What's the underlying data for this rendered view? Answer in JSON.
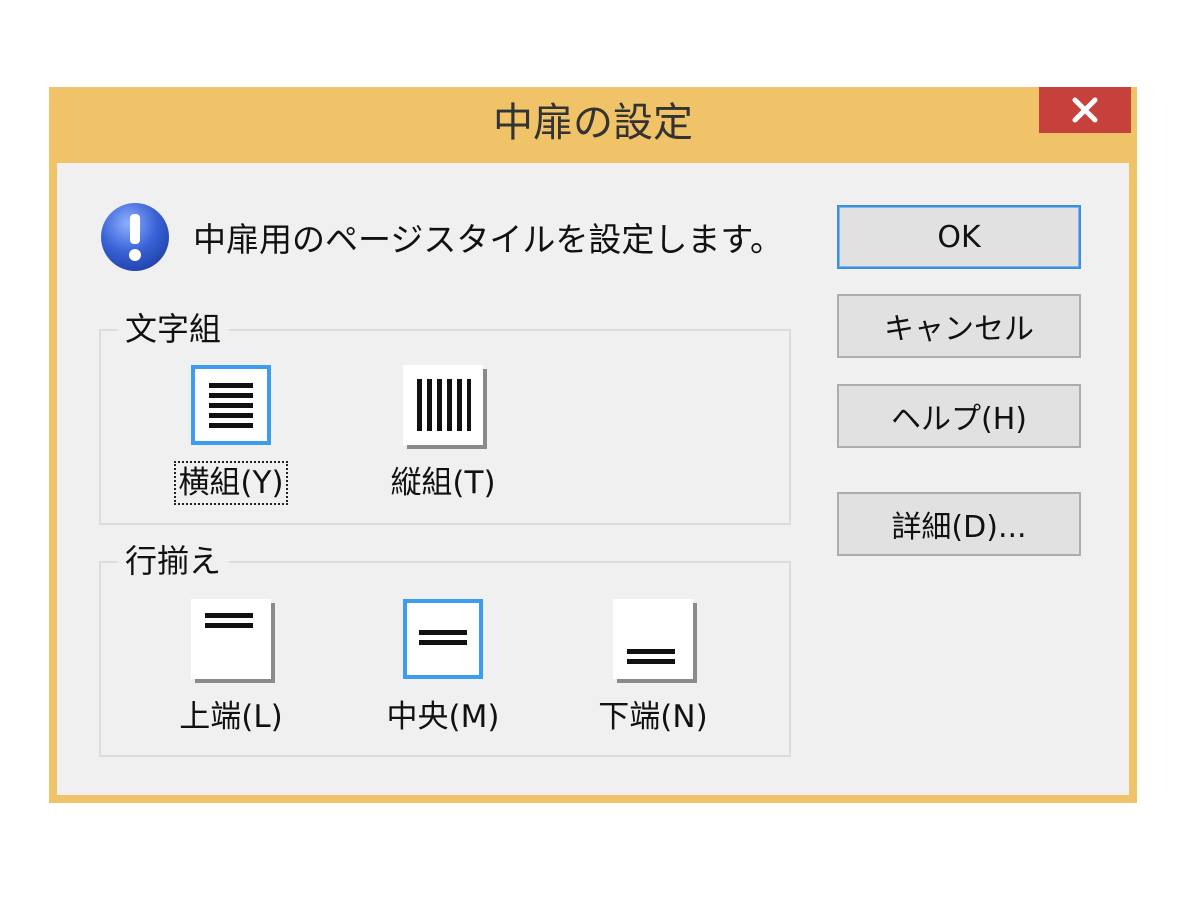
{
  "dialog": {
    "title": "中扉の設定",
    "close_label": "×"
  },
  "message": {
    "icon": "info-icon",
    "text": "中扉用のページスタイルを設定します。"
  },
  "text_direction": {
    "label": "文字組",
    "options": [
      {
        "label": "横組(Y)",
        "icon": "horizontal-lines-icon",
        "selected": true
      },
      {
        "label": "縦組(T)",
        "icon": "vertical-lines-icon",
        "selected": false
      }
    ]
  },
  "alignment": {
    "label": "行揃え",
    "options": [
      {
        "label": "上端(L)",
        "icon": "align-top-icon",
        "selected": false
      },
      {
        "label": "中央(M)",
        "icon": "align-center-icon",
        "selected": true
      },
      {
        "label": "下端(N)",
        "icon": "align-bottom-icon",
        "selected": false
      }
    ]
  },
  "buttons": {
    "ok": "OK",
    "cancel": "キャンセル",
    "help": "ヘルプ(H)",
    "details": "詳細(D)..."
  },
  "colors": {
    "frame": "#f0c368",
    "close": "#c7413c",
    "selection": "#3b9cf0",
    "info": "#3a62d6"
  }
}
